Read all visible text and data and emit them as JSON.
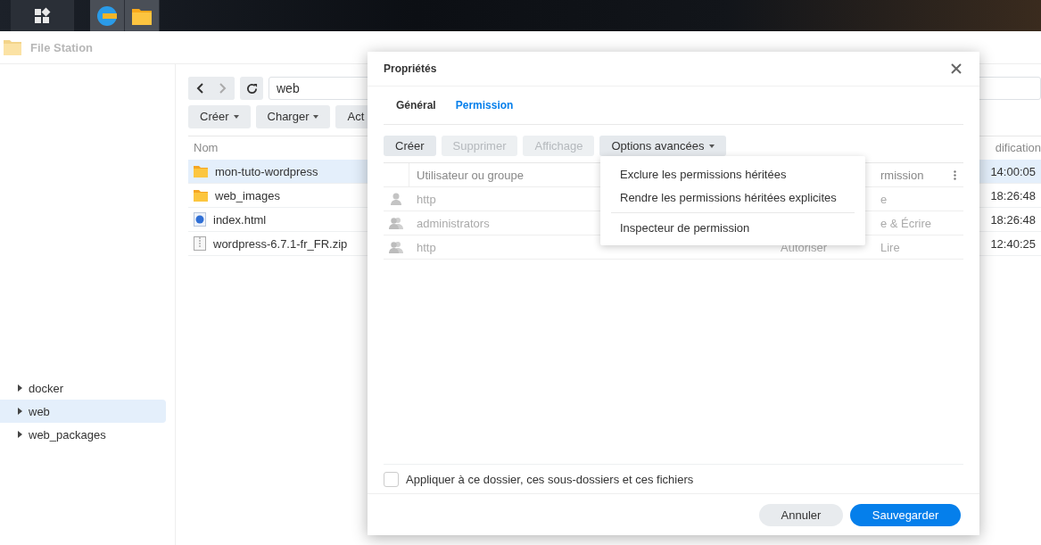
{
  "taskbar": {
    "apps": [
      {
        "kind": "grid"
      },
      {
        "kind": "browser"
      },
      {
        "kind": "folder"
      }
    ]
  },
  "file_station": {
    "title": "File Station",
    "sidebar": {
      "items": [
        {
          "label": "docker",
          "selected": false
        },
        {
          "label": "web",
          "selected": true
        },
        {
          "label": "web_packages",
          "selected": false
        }
      ]
    },
    "path": "web",
    "toolbar": [
      {
        "label": "Créer",
        "has_menu": true
      },
      {
        "label": "Charger",
        "has_menu": true
      },
      {
        "label": "Act",
        "has_menu": false
      }
    ],
    "columns": {
      "name": "Nom",
      "column_2": "dification"
    },
    "files": [
      {
        "name": "mon-tuto-wordpress",
        "kind": "folder",
        "time": "14:00:05",
        "selected": true
      },
      {
        "name": "web_images",
        "kind": "folder",
        "time": "18:26:48",
        "selected": false
      },
      {
        "name": "index.html",
        "kind": "html",
        "time": "18:26:48",
        "selected": false
      },
      {
        "name": "wordpress-6.7.1-fr_FR.zip",
        "kind": "zip",
        "time": "12:40:25",
        "selected": false
      }
    ]
  },
  "dialog": {
    "title": "Propriétés",
    "tabs": [
      {
        "label": "Général",
        "selected": false
      },
      {
        "label": "Permission",
        "selected": true
      }
    ],
    "buttons": [
      {
        "label": "Créer",
        "disabled": false,
        "has_menu": false
      },
      {
        "label": "Supprimer",
        "disabled": true,
        "has_menu": false
      },
      {
        "label": "Affichage",
        "disabled": true,
        "has_menu": false
      },
      {
        "label": "Options avancées",
        "disabled": false,
        "has_menu": true
      }
    ],
    "menu": {
      "items": [
        {
          "label": "Exclure les permissions héritées",
          "separator_before": false
        },
        {
          "label": "Rendre les permissions héritées explicites",
          "separator_before": false
        },
        {
          "label": "Inspecteur de permission",
          "separator_before": true
        }
      ]
    },
    "table": {
      "columns": {
        "user": "Utilisateur ou groupe",
        "permission": "rmission"
      },
      "rows": [
        {
          "kind": "user",
          "name": "http",
          "permission": "e"
        },
        {
          "kind": "group",
          "name": "administrators",
          "permission": "e & Écrire"
        },
        {
          "kind": "group",
          "name": "http",
          "type": "Autoriser",
          "permission": "Lire"
        }
      ]
    },
    "apply": {
      "label": "Appliquer à ce dossier, ces sous-dossiers et ces fichiers",
      "checked": false
    },
    "footer": [
      {
        "label": "Annuler",
        "kind": "secondary"
      },
      {
        "label": "Sauvegarder",
        "kind": "primary"
      }
    ]
  }
}
